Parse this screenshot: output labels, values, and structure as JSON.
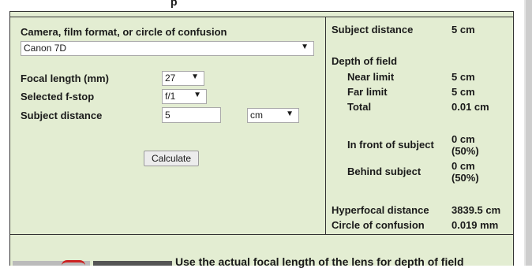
{
  "page": {
    "title_fragment": "p"
  },
  "left": {
    "camera_label": "Camera, film format, or circle of confusion",
    "camera_select": "Canon 7D",
    "focal_label": "Focal length (mm)",
    "focal_select": "27",
    "fstop_label": "Selected f-stop",
    "fstop_select": "f/1",
    "distance_label": "Subject distance",
    "distance_value": "5",
    "distance_unit": "cm",
    "calculate_label": "Calculate"
  },
  "right": {
    "subject_distance_label": "Subject distance",
    "subject_distance_value": "5 cm",
    "dof_label": "Depth of field",
    "near_label": "Near limit",
    "near_value": "5 cm",
    "far_label": "Far limit",
    "far_value": "5 cm",
    "total_label": "Total",
    "total_value": "0.01 cm",
    "front_label": "In front of subject",
    "front_value_1": "0 cm",
    "front_value_2": "(50%)",
    "behind_label": "Behind subject",
    "behind_value_1": "0 cm",
    "behind_value_2": "(50%)",
    "hyperfocal_label": "Hyperfocal distance",
    "hyperfocal_value": "3839.5 cm",
    "coc_label": "Circle of confusion",
    "coc_value": "0.019 mm"
  },
  "footer": {
    "caption": "Use the actual focal length of the lens for depth of field"
  },
  "colors": {
    "panel": "#e3edd2",
    "border": "#333333",
    "accent_red": "#cc2222"
  }
}
